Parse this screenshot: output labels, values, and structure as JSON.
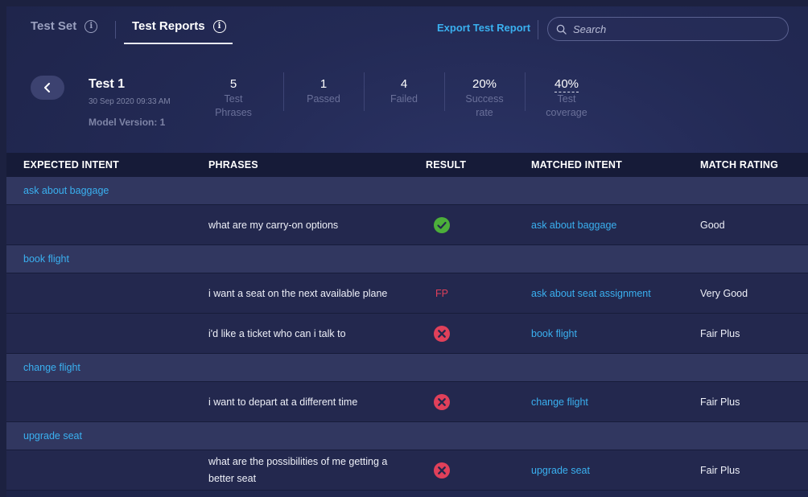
{
  "tabs": {
    "test_set": "Test Set",
    "test_reports": "Test Reports"
  },
  "toolbar": {
    "export_label": "Export Test Report",
    "search_placeholder": "Search"
  },
  "summary": {
    "name": "Test 1",
    "date": "30 Sep 2020 09:33 AM",
    "model_version": "Model Version: 1",
    "stats": [
      {
        "value": "5",
        "label_line1": "Test",
        "label_line2": "Phrases"
      },
      {
        "value": "1",
        "label_line1": "Passed",
        "label_line2": ""
      },
      {
        "value": "4",
        "label_line1": "Failed",
        "label_line2": ""
      },
      {
        "value": "20%",
        "label_line1": "Success",
        "label_line2": "rate"
      },
      {
        "value": "40%",
        "label_line1": "Test",
        "label_line2": "coverage"
      }
    ]
  },
  "table": {
    "headers": [
      "EXPECTED INTENT",
      "PHRASES",
      "RESULT",
      "MATCHED INTENT",
      "MATCH RATING"
    ],
    "groups": [
      {
        "intent": "ask about baggage",
        "rows": [
          {
            "phrase": "what are my carry-on options",
            "result": "pass",
            "matched": "ask about baggage",
            "rating": "Good"
          }
        ]
      },
      {
        "intent": "book flight",
        "rows": [
          {
            "phrase": "i want a seat on the next available plane",
            "result": "FP",
            "matched": "ask about seat assignment",
            "rating": "Very Good"
          },
          {
            "phrase": "i'd like a ticket who can i talk to",
            "result": "fail",
            "matched": "book flight",
            "rating": "Fair Plus"
          }
        ]
      },
      {
        "intent": "change flight",
        "rows": [
          {
            "phrase": "i want to depart at a different time",
            "result": "fail",
            "matched": "change flight",
            "rating": "Fair Plus"
          }
        ]
      },
      {
        "intent": "upgrade seat",
        "rows": [
          {
            "phrase_line1": "what are the possibilities of me getting a",
            "phrase_line2": "better seat",
            "result": "fail",
            "matched": "upgrade seat",
            "rating": "Fair Plus"
          }
        ]
      }
    ]
  },
  "colors": {
    "accent": "#3ab0f0",
    "pass": "#4caf3a",
    "fail": "#e0405a"
  }
}
